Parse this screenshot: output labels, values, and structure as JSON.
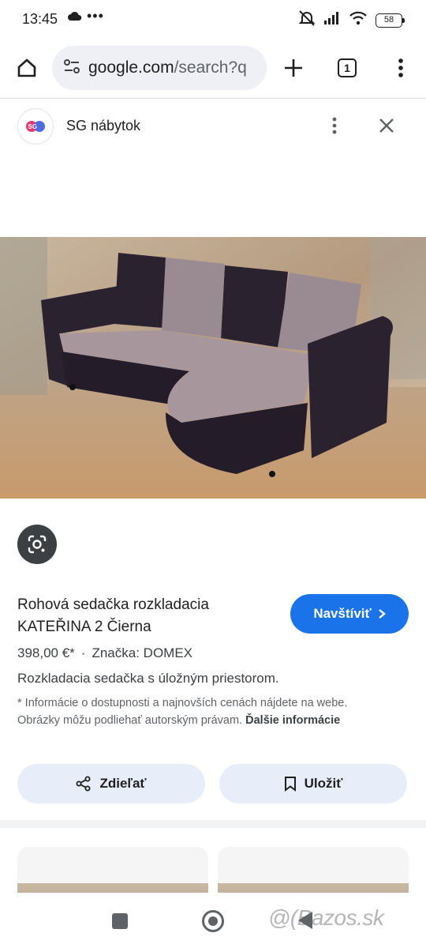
{
  "status_bar": {
    "time": "13:45",
    "dots": "•••",
    "battery": "58"
  },
  "browser": {
    "url_host": "google.com",
    "url_rest": "/search?q",
    "tab_count": "1"
  },
  "site": {
    "logo_text": "SG",
    "name": "SG nábytok"
  },
  "product": {
    "title": "Rohová sedačka rozkladacia KATEŘINA 2 Čierna",
    "visit_label": "Navštíviť",
    "price": "398,00 €*",
    "separator": "·",
    "brand": "Značka: DOMEX",
    "description": "Rozkladacia sedačka s úložným priestorom.",
    "disclaimer": "* Informácie o dostupnosti a najnovších cenách nájdete na webe. Obrázky môžu podliehať autorským právam.",
    "more_info": "Ďalšie informácie"
  },
  "actions": {
    "share_label": "Zdieľať",
    "save_label": "Uložiť"
  },
  "watermark": "@(Bazos.sk",
  "icons": {
    "home": "home-icon",
    "site_settings": "tune-icon",
    "new_tab": "plus-icon",
    "menu": "more-vert-icon",
    "close": "close-icon",
    "lens": "google-lens-icon",
    "share": "share-icon",
    "bookmark": "bookmark-icon"
  },
  "colors": {
    "accent": "#1a73e8",
    "chip_bg": "#e8eef9",
    "url_bg": "#eef0f6"
  }
}
